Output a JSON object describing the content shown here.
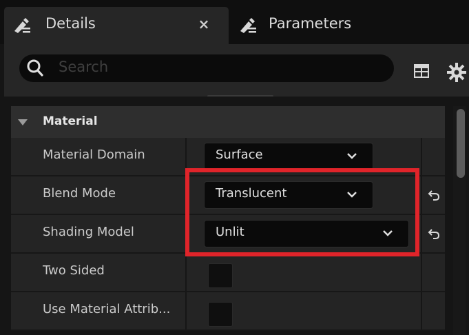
{
  "tabs": [
    {
      "label": "Details",
      "icon": "details-edit-icon",
      "active": true,
      "close_glyph": "×"
    },
    {
      "label": "Parameters",
      "icon": "parameters-edit-icon",
      "active": false
    }
  ],
  "search": {
    "placeholder": "Search",
    "value": ""
  },
  "toolbar": {
    "icons": [
      "table-view-icon",
      "settings-gear-icon"
    ]
  },
  "category": {
    "label": "Material",
    "expanded": true
  },
  "properties": [
    {
      "label": "Material Domain",
      "type": "dropdown",
      "value": "Surface",
      "reset": false
    },
    {
      "label": "Blend Mode",
      "type": "dropdown",
      "value": "Translucent",
      "reset": true
    },
    {
      "label": "Shading Model",
      "type": "dropdown",
      "value": "Unlit",
      "reset": true
    },
    {
      "label": "Two Sided",
      "type": "checkbox",
      "checked": false
    },
    {
      "label": "Use Material Attrib...",
      "type": "checkbox",
      "checked": false
    }
  ],
  "colors": {
    "highlight": "#e0242a",
    "panel": "#242424",
    "background": "#151515"
  }
}
